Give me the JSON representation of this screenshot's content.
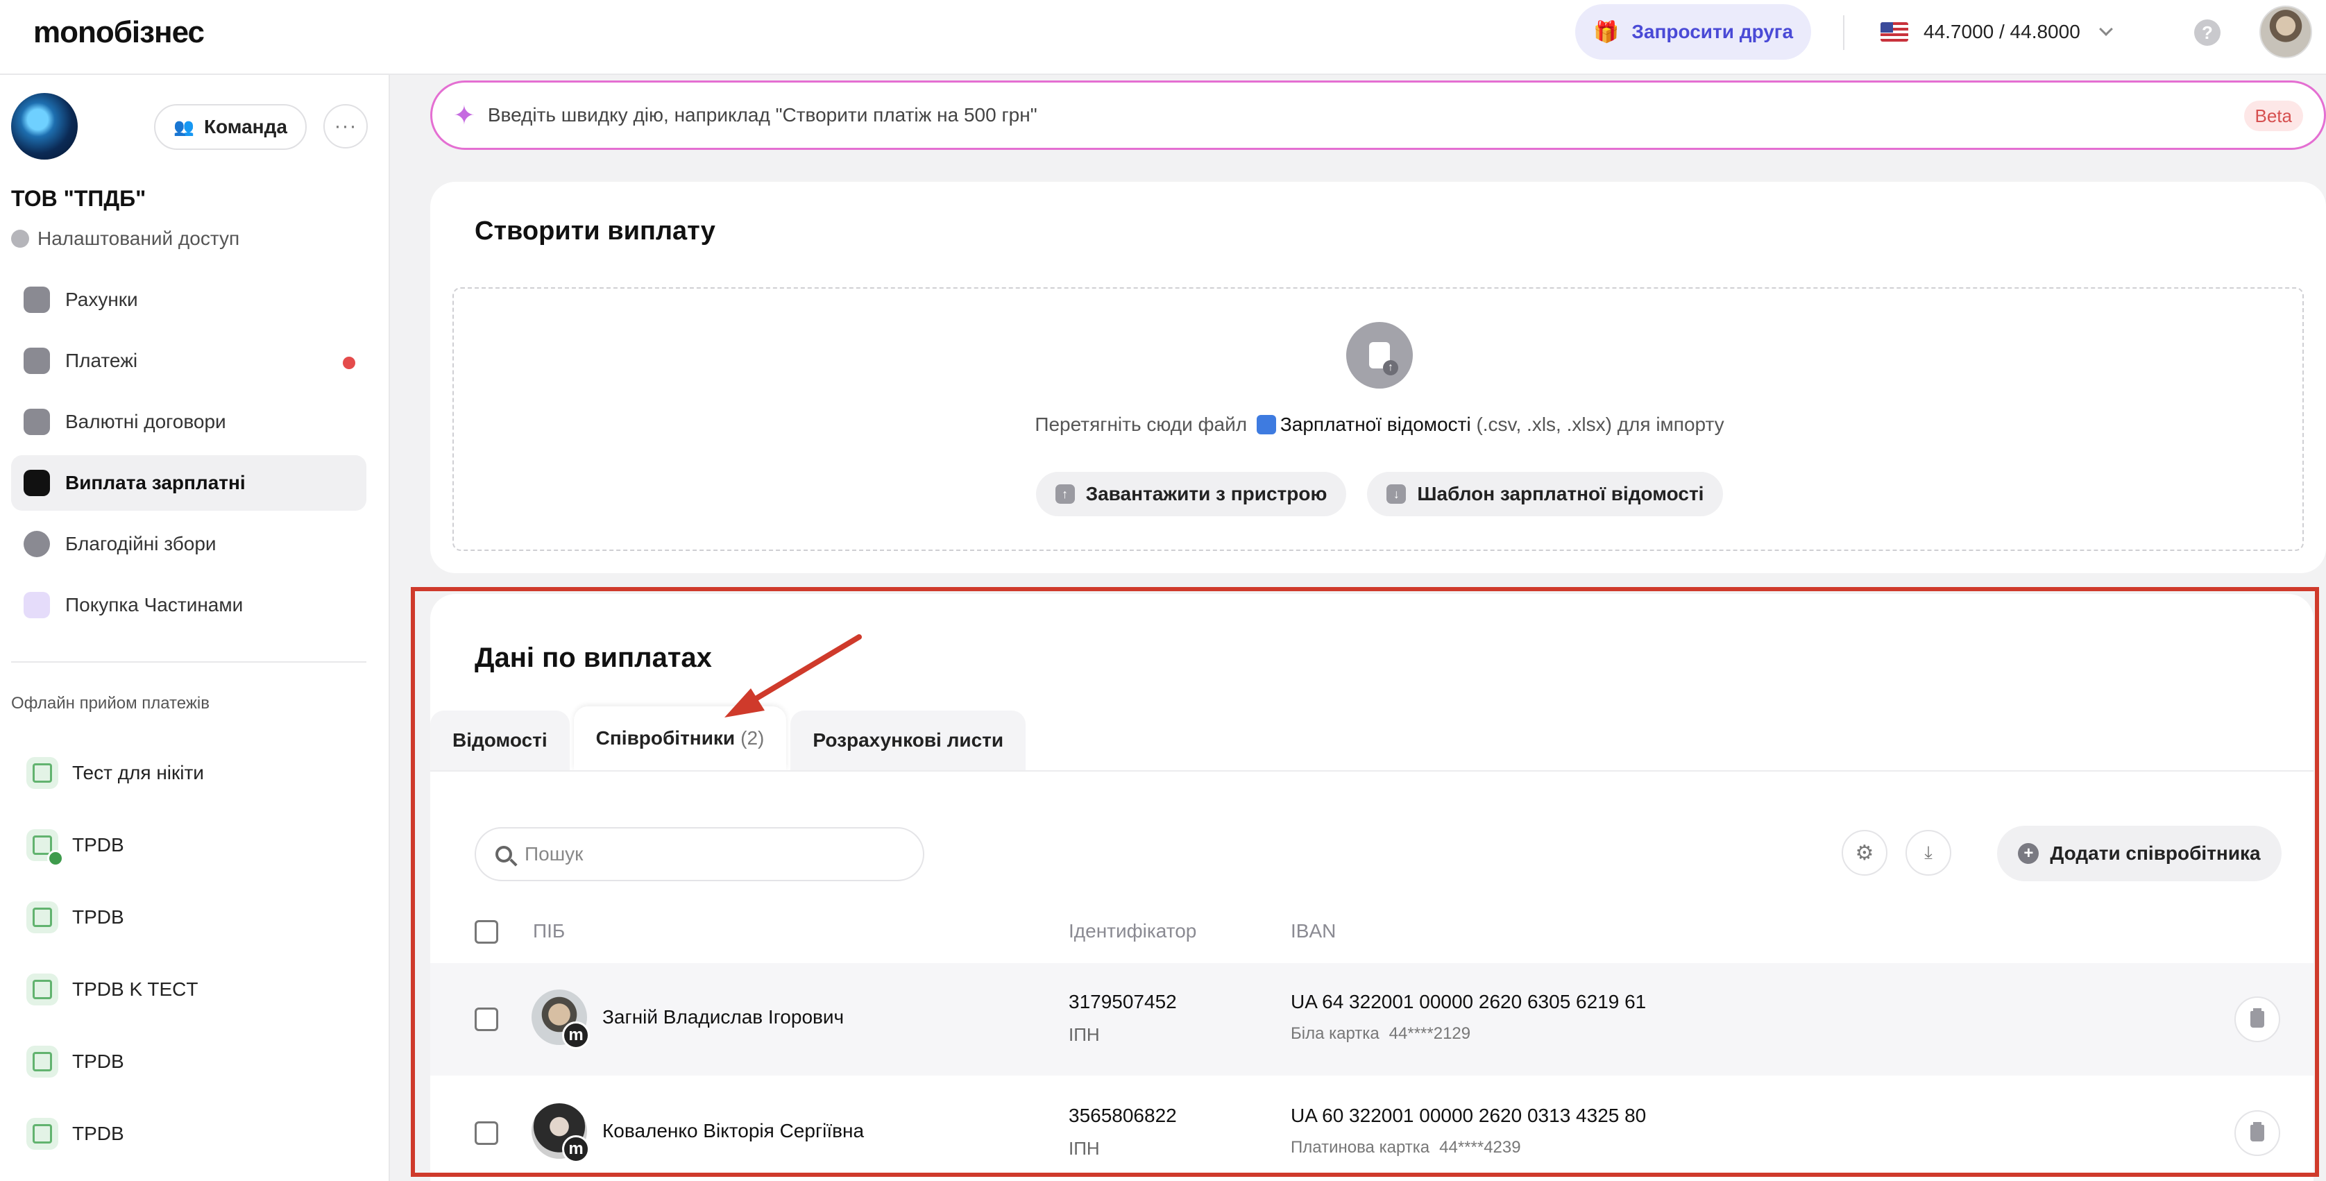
{
  "app": {
    "logo": "monoбізнес"
  },
  "header": {
    "invite_label": "Запросити друга",
    "rate": "44.7000 / 44.8000",
    "help_label": "?"
  },
  "sidebar": {
    "team_label": "Команда",
    "more_label": "···",
    "org_name": "ТОВ \"ТПДБ\"",
    "access_label": "Налаштований доступ",
    "items": [
      {
        "label": "Рахунки",
        "icon": "wallet-icon"
      },
      {
        "label": "Платежі",
        "icon": "transfer-icon",
        "notification": true
      },
      {
        "label": "Валютні договори",
        "icon": "currency-contract-icon"
      },
      {
        "label": "Виплата зарплатні",
        "icon": "salary-icon",
        "active": true
      },
      {
        "label": "Благодійні збори",
        "icon": "charity-icon"
      },
      {
        "label": "Покупка Частинами",
        "icon": "paw-icon"
      }
    ],
    "offline_title": "Офлайн прийом платежів",
    "offline_items": [
      "Тест для нікіти",
      "TPDB",
      "TPDB",
      "TPDB K TECT",
      "TPDB",
      "TPDB"
    ]
  },
  "quick_action": {
    "placeholder": "Введіть швидку дію, наприклад \"Створити платіж на 500 грн\"",
    "beta": "Beta"
  },
  "create_payout": {
    "title": "Створити виплату",
    "drop_before": "Перетягніть сюди файл",
    "drop_highlight": "Зарплатної відомості",
    "drop_after": "(.csv, .xls, .xlsx) для імпорту",
    "upload_button": "Завантажити з пристрою",
    "template_button": "Шаблон зарплатної відомості"
  },
  "payout_data": {
    "title": "Дані по виплатах",
    "tabs": [
      {
        "label": "Відомості"
      },
      {
        "label": "Співробітники",
        "count": "(2)"
      },
      {
        "label": "Розрахункові листи"
      }
    ],
    "search_placeholder": "Пошук",
    "add_button": "Додати співробітника",
    "columns": {
      "name": "ПІБ",
      "id": "Ідентифікатор",
      "iban": "IBAN"
    },
    "rows": [
      {
        "name": "Загній Владислав Ігорович",
        "id": "3179507452",
        "id_label": "ІПН",
        "iban": "UA 64 322001 00000 2620 6305 6219 61",
        "card_type": "Біла картка",
        "card_mask": "44****2129",
        "badge": "m"
      },
      {
        "name": "Коваленко Вікторія Сергіївна",
        "id": "3565806822",
        "id_label": "ІПН",
        "iban": "UA 60 322001 00000 2620 0313 4325 80",
        "card_type": "Платинова картка",
        "card_mask": "44****4239",
        "badge": "m"
      }
    ]
  },
  "colors": {
    "accent": "#4a4ad6",
    "highlight": "#cf3a2b",
    "quick_border": "#e46fd2"
  }
}
